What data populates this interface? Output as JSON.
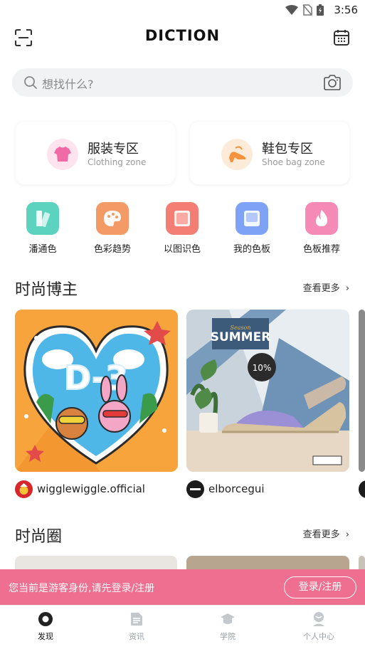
{
  "status_bar": {
    "time": "3:56"
  },
  "header": {
    "logo": "DICTION"
  },
  "search": {
    "placeholder": "想找什么?"
  },
  "zones": [
    {
      "title": "服装专区",
      "subtitle": "Clothing zone",
      "color": "#f06aa8"
    },
    {
      "title": "鞋包专区",
      "subtitle": "Shoe bag zone",
      "color": "#f5923b"
    }
  ],
  "quick_menu": [
    {
      "label": "潘通色",
      "color": "#5cd3bf",
      "icon": "pantone-icon"
    },
    {
      "label": "色彩趋势",
      "color": "#f49a66",
      "icon": "palette-icon"
    },
    {
      "label": "以图识色",
      "color": "#f47d74",
      "icon": "image-icon"
    },
    {
      "label": "我的色板",
      "color": "#7ea2f5",
      "icon": "swatch-board-icon"
    },
    {
      "label": "色板推荐",
      "color": "#f58ab7",
      "icon": "flame-icon"
    }
  ],
  "fashion_blogger": {
    "title": "时尚博主",
    "more": "查看更多",
    "cards": [
      {
        "name": "wigglewiggle.official",
        "image_text": "D-3"
      },
      {
        "name": "elborcegui",
        "image_text": "SUMMER",
        "badge": "10%",
        "small_text": "Season"
      }
    ]
  },
  "fashion_circle": {
    "title": "时尚圈",
    "more": "查看更多"
  },
  "guest_banner": {
    "text": "您当前是游客身份,请先登录/注册",
    "button": "登录/注册"
  },
  "tabbar": [
    {
      "label": "发现",
      "active": true
    },
    {
      "label": "资讯",
      "active": false
    },
    {
      "label": "学院",
      "active": false
    },
    {
      "label": "个人中心",
      "active": false
    }
  ]
}
